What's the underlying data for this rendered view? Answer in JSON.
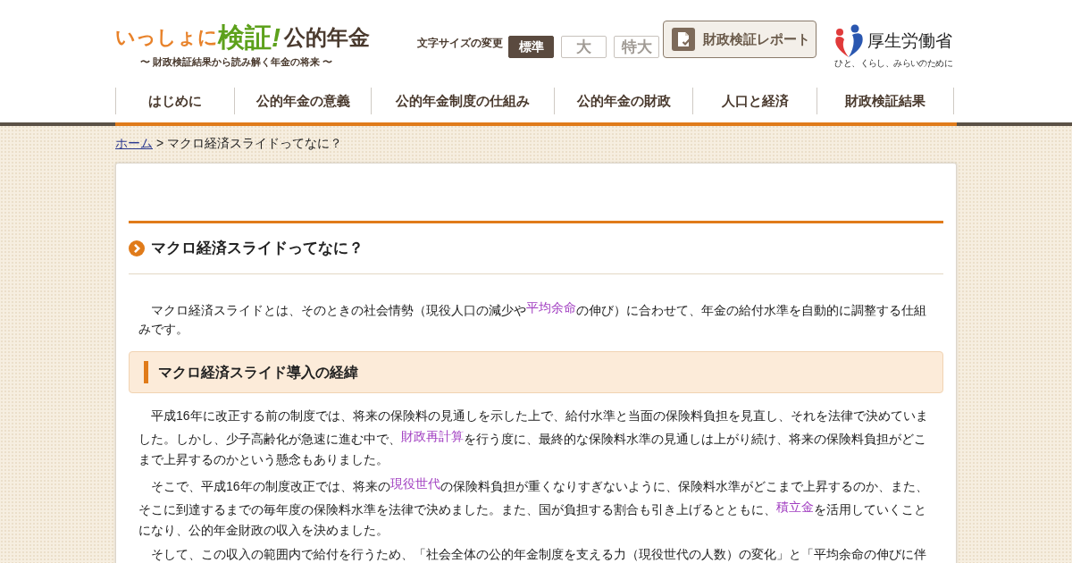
{
  "header": {
    "logo": {
      "parts": [
        {
          "kind": "lead",
          "text": "いっしょに"
        },
        {
          "kind": "accent",
          "text": "検証"
        },
        {
          "kind": "mark",
          "text": "!"
        },
        {
          "kind": "main",
          "text": "公的年金"
        }
      ],
      "subtitle": "〜 財政検証結果から読み解く年金の将来 〜"
    },
    "font_size": {
      "label": "文字サイズの変更",
      "options": [
        {
          "label": "標準",
          "selected": true
        },
        {
          "label": "大",
          "selected": false
        },
        {
          "label": "特大",
          "selected": false
        }
      ]
    },
    "report_button": {
      "label": "財政検証レポート"
    },
    "ministry": {
      "name": "厚生労働省",
      "tagline": "ひと、くらし、みらいのために"
    }
  },
  "nav": {
    "items": [
      {
        "label": "はじめに"
      },
      {
        "label": "公的年金の意義"
      },
      {
        "label": "公的年金制度の仕組み"
      },
      {
        "label": "公的年金の財政"
      },
      {
        "label": "人口と経済"
      },
      {
        "label": "財政検証結果"
      }
    ]
  },
  "breadcrumb": {
    "items": [
      {
        "kind": "link",
        "text": "ホーム"
      },
      {
        "kind": "current",
        "text": "マクロ経済スライドってなに？"
      }
    ],
    "separator": ">"
  },
  "article": {
    "title": "マクロ経済スライドってなに？",
    "intro": [
      {
        "kind": "text",
        "text": "マクロ経済スライドとは、そのときの社会情勢（現役人口の減少や"
      },
      {
        "kind": "link",
        "text": "平均余命"
      },
      {
        "kind": "text",
        "text": "の伸び）に合わせて、年金の給付水準を自動的に調整する仕組みです。"
      }
    ],
    "section": {
      "heading": "マクロ経済スライド導入の経緯",
      "paragraphs": [
        [
          {
            "kind": "text",
            "text": "平成16年に改正する前の制度では、将来の保険料の見通しを示した上で、給付水準と当面の保険料負担を見直し、それを法律で決めていました。しかし、少子高齢化が急速に進む中で、"
          },
          {
            "kind": "link",
            "text": "財政再計算"
          },
          {
            "kind": "text",
            "text": "を行う度に、最終的な保険料水準の見通しは上がり続け、将来の保険料負担がどこまで上昇するのかという懸念もありました。"
          }
        ],
        [
          {
            "kind": "text",
            "text": "そこで、平成16年の制度改正では、将来の"
          },
          {
            "kind": "link",
            "text": "現役世代"
          },
          {
            "kind": "text",
            "text": "の保険料負担が重くなりすぎないように、保険料水準がどこまで上昇するのか、また、そこに到達するまでの毎年度の保険料水準を法律で決めました。また、国が負担する割合も引き上げるとともに、"
          },
          {
            "kind": "link",
            "text": "積立金"
          },
          {
            "kind": "text",
            "text": "を活用していくことになり、公的年金財政の収入を決めました。"
          }
        ],
        [
          {
            "kind": "text",
            "text": "そして、この収入の範囲内で給付を行うため、「社会全体の公的年金制度を支える力（現役世代の人数）の変化」と「平均余命の伸びに伴"
          }
        ]
      ]
    }
  }
}
